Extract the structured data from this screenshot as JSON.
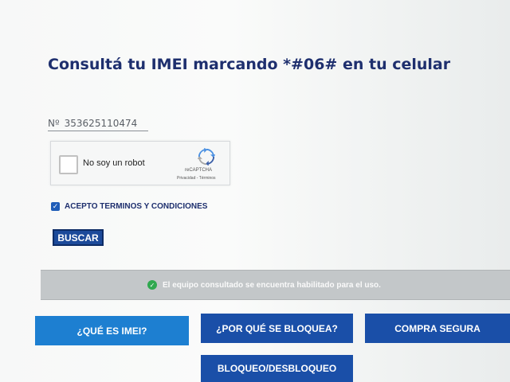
{
  "title": "Consultá tu IMEI marcando *#06# en tu celular",
  "imei": {
    "prefix": "Nº",
    "value": "353625110474"
  },
  "captcha": {
    "label": "No soy un robot",
    "brand": "reCAPTCHA",
    "links": "Privacidad - Términos"
  },
  "terms": {
    "checked": true,
    "label": "ACEPTO TERMINOS Y CONDICIONES"
  },
  "search_button": "BUSCAR",
  "result": {
    "message": "El equipo consultado se encuentra habilitado para el uso."
  },
  "nav": {
    "what_is_imei": "¿QUÉ ES IMEI?",
    "why_blocked": "¿POR QUÉ SE BLOQUEA?",
    "safe_purchase": "COMPRA SEGURA",
    "block_unblock": "BLOQUEO/DESBLOQUEO"
  },
  "colors": {
    "title": "#1e2f6e",
    "primary_button": "#1d7fd1",
    "dark_button": "#1a4fa8",
    "success_icon": "#2fa84f"
  }
}
